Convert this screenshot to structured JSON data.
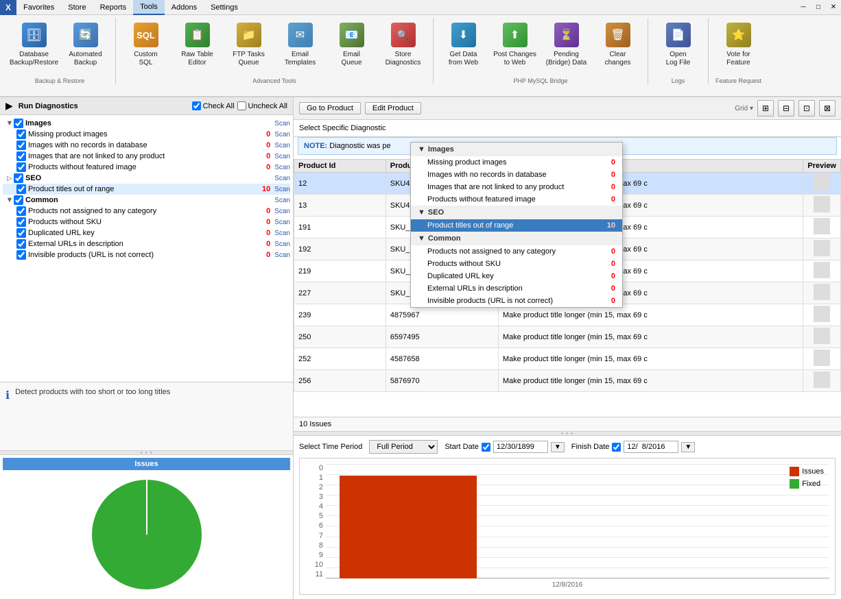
{
  "app": {
    "logo": "X",
    "title": "Tools"
  },
  "menu": {
    "items": [
      "Favorites",
      "Store",
      "Reports",
      "Tools",
      "Addons",
      "Settings"
    ],
    "active": "Tools"
  },
  "toolbar": {
    "buttons": [
      {
        "id": "db-backup",
        "label": "Database\nBackup/Restore",
        "icon": "🗄",
        "section": "Backup & Restore"
      },
      {
        "id": "auto-backup",
        "label": "Automated\nBackup",
        "icon": "🔄",
        "section": "Backup & Restore"
      },
      {
        "id": "custom-sql",
        "label": "Custom\nSQL",
        "icon": "SQL",
        "section": "Advanced Tools"
      },
      {
        "id": "raw-table",
        "label": "Raw Table\nEditor",
        "icon": "📋",
        "section": "Advanced Tools"
      },
      {
        "id": "ftp-tasks",
        "label": "FTP Tasks\nQueue",
        "icon": "📁",
        "section": "Advanced Tools"
      },
      {
        "id": "email-templates",
        "label": "Email\nTemplates",
        "icon": "✉",
        "section": "Advanced Tools"
      },
      {
        "id": "email-queue",
        "label": "Email\nQueue",
        "icon": "📧",
        "section": "Advanced Tools"
      },
      {
        "id": "store-diag",
        "label": "Store\nDiagnostics",
        "icon": "🔍",
        "section": "Advanced Tools"
      },
      {
        "id": "get-data",
        "label": "Get Data\nfrom Web",
        "icon": "⬇",
        "section": "PHP MySQL Bridge"
      },
      {
        "id": "post-changes",
        "label": "Post Changes\nto Web",
        "icon": "⬆",
        "section": "PHP MySQL Bridge"
      },
      {
        "id": "pending-bridge",
        "label": "Pending\n(Bridge) Data",
        "icon": "⏳",
        "section": "PHP MySQL Bridge"
      },
      {
        "id": "clear-changes",
        "label": "Clear\nchanges",
        "icon": "🗑",
        "section": "PHP MySQL Bridge"
      },
      {
        "id": "open-log",
        "label": "Open\nLog File",
        "icon": "📄",
        "section": "Logs"
      },
      {
        "id": "vote-feature",
        "label": "Vote for\nFeature",
        "icon": "⭐",
        "section": "Feature Request"
      }
    ],
    "sections": [
      {
        "label": "Backup & Restore",
        "count": 2
      },
      {
        "label": "Advanced Tools",
        "count": 6
      },
      {
        "label": "PHP MySQL Bridge",
        "count": 4
      },
      {
        "label": "Logs",
        "count": 1
      },
      {
        "label": "Feature Request",
        "count": 1
      }
    ]
  },
  "diagnostics": {
    "header": "Run Diagnostics",
    "check_all": "Check All",
    "uncheck_all": "Uncheck All",
    "tree": [
      {
        "id": "images",
        "label": "Images",
        "checked": true,
        "expanded": true,
        "children": [
          {
            "id": "missing-images",
            "label": "Missing product images",
            "checked": true,
            "count": "0",
            "scan": "Scan"
          },
          {
            "id": "images-no-records",
            "label": "Images with no records in database",
            "checked": true,
            "count": "0",
            "scan": "Scan"
          },
          {
            "id": "images-not-linked",
            "label": "Images that are not linked to any product",
            "checked": true,
            "count": "0",
            "scan": "Scan"
          },
          {
            "id": "products-no-image",
            "label": "Products without featured image",
            "checked": true,
            "count": "0",
            "scan": "Scan"
          }
        ]
      },
      {
        "id": "seo",
        "label": "SEO",
        "checked": true,
        "expanded": true,
        "children": [
          {
            "id": "product-titles",
            "label": "Product titles out of range",
            "checked": true,
            "count": "10",
            "scan": "Scan",
            "selected": true
          }
        ]
      },
      {
        "id": "common",
        "label": "Common",
        "checked": true,
        "expanded": true,
        "children": [
          {
            "id": "not-assigned",
            "label": "Products not assigned to any category",
            "checked": true,
            "count": "0",
            "scan": "Scan"
          },
          {
            "id": "no-sku",
            "label": "Products without SKU",
            "checked": true,
            "count": "0",
            "scan": "Scan"
          },
          {
            "id": "dup-url",
            "label": "Duplicated URL key",
            "checked": true,
            "count": "0",
            "scan": "Scan"
          },
          {
            "id": "ext-urls",
            "label": "External URLs in description",
            "checked": true,
            "count": "0",
            "scan": "Scan"
          },
          {
            "id": "invisible",
            "label": "Invisible products (URL is not correct)",
            "checked": true,
            "count": "0",
            "scan": "Scan"
          }
        ]
      }
    ],
    "info_text": "Detect products with too short or too long titles"
  },
  "right_toolbar": {
    "goto_product": "Go to Product",
    "edit_product": "Edit Product"
  },
  "select_diagnostic": {
    "label": "Select Specific Diagnostic",
    "value": "Product titles out of range",
    "options": {
      "images_section": "Images",
      "items": [
        {
          "label": "Missing product images",
          "count": "0"
        },
        {
          "label": "Images with no records in database",
          "count": "0"
        },
        {
          "label": "Images that are not linked to any product",
          "count": "0"
        },
        {
          "label": "Products without featured image",
          "count": "0"
        }
      ],
      "seo_section": "SEO",
      "seo_items": [
        {
          "label": "Product titles out of range",
          "count": "10",
          "selected": true
        }
      ],
      "common_section": "Common",
      "common_items": [
        {
          "label": "Products not assigned to any category",
          "count": "0"
        },
        {
          "label": "Products without SKU",
          "count": "0"
        },
        {
          "label": "Duplicated URL key",
          "count": "0"
        },
        {
          "label": "External URLs in description",
          "count": "0"
        },
        {
          "label": "Invisible products (URL is not correct)",
          "count": "0"
        }
      ]
    }
  },
  "note": {
    "prefix": "NOTE:",
    "text": "Diagnostic was pe"
  },
  "table": {
    "columns": [
      "Product Id",
      "Product SKU",
      "Hint",
      "Preview"
    ],
    "rows": [
      {
        "id": "12",
        "sku": "SKU45763",
        "hint": "Make product title longer (min 15, max 69 c",
        "selected": true
      },
      {
        "id": "13",
        "sku": "SKU47523",
        "hint": "Make product title longer (min 15, max 69 c"
      },
      {
        "id": "191",
        "sku": "SKU_prada_c",
        "hint": "Make product title longer (min 15, max 69 c"
      },
      {
        "id": "192",
        "sku": "SKU_bam_gu",
        "hint": "Make product title longer (min 15, max 69 c"
      },
      {
        "id": "219",
        "sku": "SKU_jadore_",
        "hint": "Make product title longer (min 15, max 69 c"
      },
      {
        "id": "227",
        "sku": "SKU_million_r",
        "hint": "Make product title longer (min 15, max 69 c"
      },
      {
        "id": "239",
        "sku": "4875967",
        "hint": "Make product title longer (min 15, max 69 c"
      },
      {
        "id": "250",
        "sku": "6597495",
        "hint": "Make product title longer (min 15, max 69 c"
      },
      {
        "id": "252",
        "sku": "4587658",
        "hint": "Make product title longer (min 15, max 69 c"
      },
      {
        "id": "256",
        "sku": "5876970",
        "hint": "Make product title longer (min 15, max 69 c"
      }
    ]
  },
  "issues_count": "10 Issues",
  "chart_section": {
    "issues_label": "Issues",
    "title": "Issues",
    "time_period_label": "Select Time Period",
    "time_period_value": "Full Period",
    "start_date_label": "Start Date",
    "start_date_value": "12/30/1899",
    "finish_date_label": "Finish Date",
    "finish_date_value": "12/  8/2016",
    "x_label": "12/8/2016",
    "y_values": [
      "0",
      "1",
      "2",
      "3",
      "4",
      "5",
      "6",
      "7",
      "8",
      "9",
      "10",
      "11"
    ],
    "bar_issues_height_pct": "90",
    "bar_issues_label": "Issues",
    "bar_fixed_label": "Fixed"
  }
}
